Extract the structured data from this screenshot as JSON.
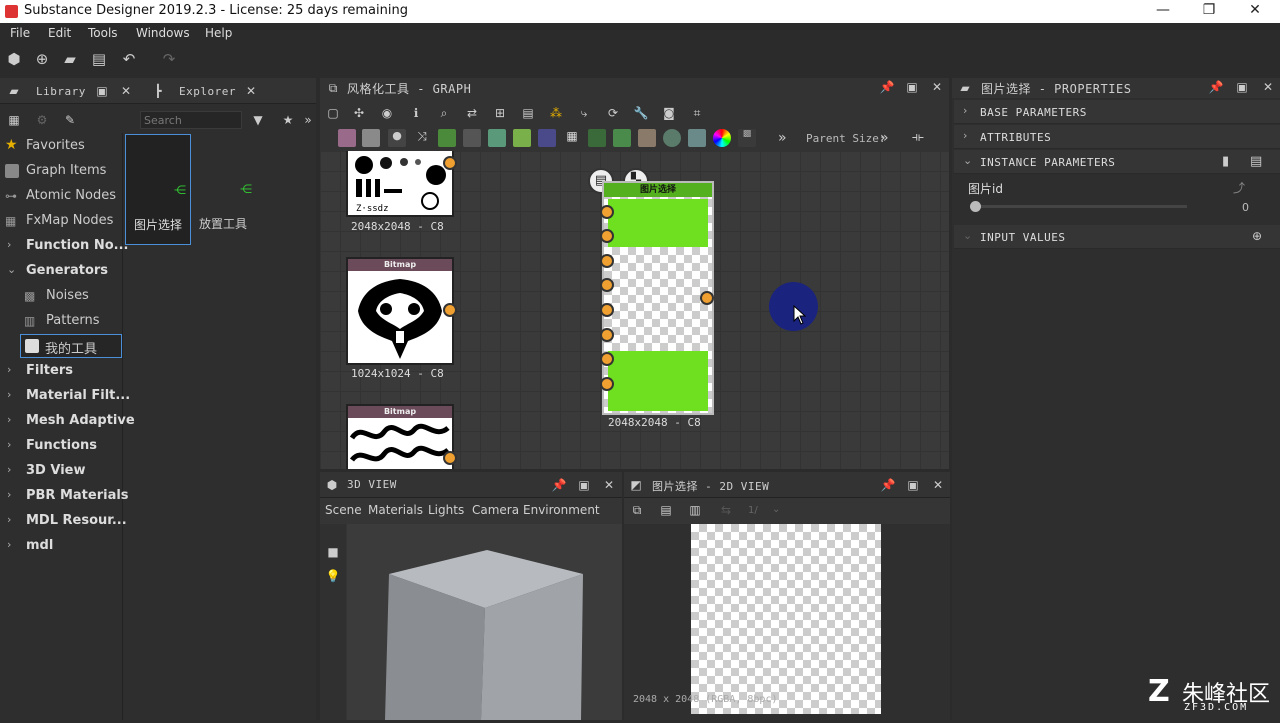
{
  "window": {
    "title": "Substance Designer 2019.2.3 - License: 25 days remaining",
    "minimize": "—",
    "maximize": "❐",
    "close": "✕"
  },
  "menu": [
    "File",
    "Edit",
    "Tools",
    "Windows",
    "Help"
  ],
  "library": {
    "tab_library": "Library",
    "tab_explorer": "Explorer",
    "search_placeholder": "Search",
    "items": [
      {
        "label": "Favorites"
      },
      {
        "label": "Graph Items"
      },
      {
        "label": "Atomic Nodes"
      },
      {
        "label": "FxMap Nodes"
      },
      {
        "label": "Function No..."
      },
      {
        "label": "Generators"
      },
      {
        "label": "Noises"
      },
      {
        "label": "Patterns"
      },
      {
        "label": "我的工具"
      },
      {
        "label": "Filters"
      },
      {
        "label": "Material Filt..."
      },
      {
        "label": "Mesh Adaptive"
      },
      {
        "label": "Functions"
      },
      {
        "label": "3D View"
      },
      {
        "label": "PBR Materials"
      },
      {
        "label": "MDL Resour..."
      },
      {
        "label": "mdl"
      }
    ],
    "thumbs": [
      {
        "label": "图片选择"
      },
      {
        "label": "放置工具"
      }
    ]
  },
  "graph": {
    "title": "风格化工具 - GRAPH",
    "parent_size": "Parent Size:",
    "nodes": [
      {
        "res": "2048x2048 - C8"
      },
      {
        "title": "Bitmap",
        "res": "1024x1024 - C8"
      },
      {
        "title": "Bitmap"
      },
      {
        "title": "图片选择",
        "res": "2048x2048 - C8"
      }
    ],
    "atlas_text": "Z·ssdz"
  },
  "view3d": {
    "title": "3D VIEW",
    "menu": [
      "Scene",
      "Materials",
      "Lights",
      "Camera",
      "Environment"
    ]
  },
  "view2d": {
    "title": "图片选择 - 2D VIEW",
    "zoom": "1/",
    "status": "2048 x 2048 (RGBA, 8bpc)"
  },
  "properties": {
    "title": "图片选择 - PROPERTIES",
    "sections": [
      "BASE PARAMETERS",
      "ATTRIBUTES",
      "INSTANCE PARAMETERS",
      "INPUT VALUES"
    ],
    "param_label": "图片id",
    "param_value": "0",
    "slider_value": 0
  },
  "watermark": {
    "text": "朱峰社区",
    "sub": "ZF3D.COM"
  },
  "colors": {
    "accent_green": "#6fe020",
    "port_orange": "#f0a030",
    "cursor_blue": "#1a237e"
  }
}
